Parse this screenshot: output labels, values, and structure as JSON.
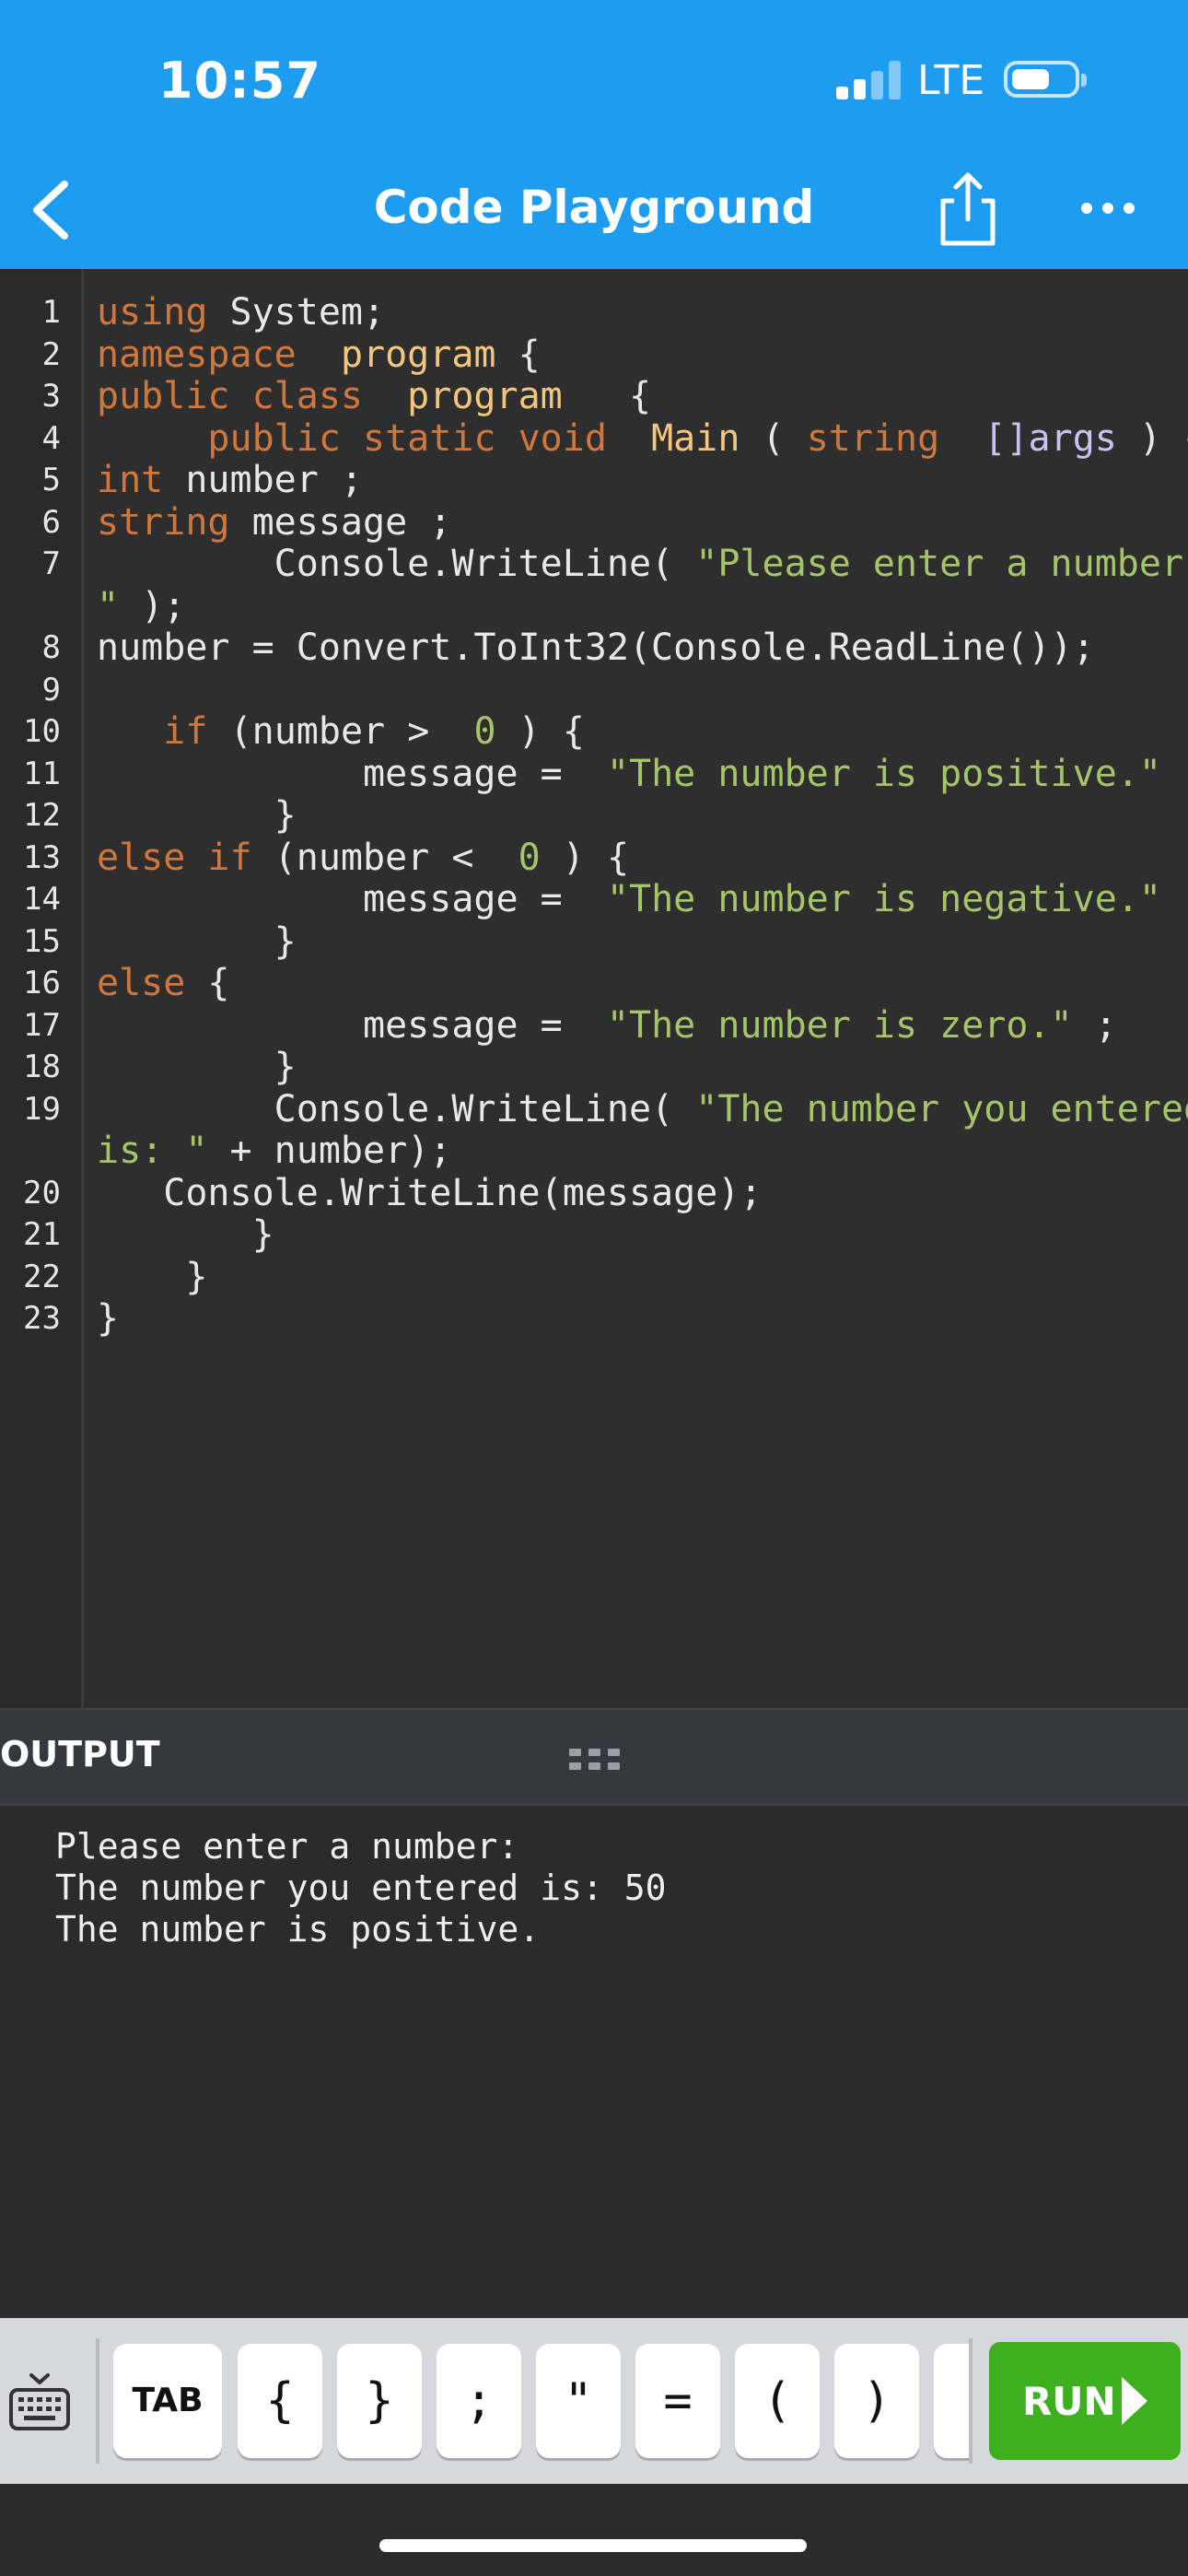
{
  "status_bar": {
    "time": "10:57",
    "network": "LTE"
  },
  "header": {
    "title": "Code Playground"
  },
  "code_lines": [
    {
      "n": "1"
    },
    {
      "n": "2"
    },
    {
      "n": "3"
    },
    {
      "n": "4"
    },
    {
      "n": "5"
    },
    {
      "n": "6"
    },
    {
      "n": "7"
    },
    {
      "n": ""
    },
    {
      "n": "8"
    },
    {
      "n": "9"
    },
    {
      "n": "10"
    },
    {
      "n": "11"
    },
    {
      "n": "12"
    },
    {
      "n": "13"
    },
    {
      "n": "14"
    },
    {
      "n": "15"
    },
    {
      "n": "16"
    },
    {
      "n": "17"
    },
    {
      "n": "18"
    },
    {
      "n": "19"
    },
    {
      "n": ""
    },
    {
      "n": "20"
    },
    {
      "n": "21"
    },
    {
      "n": "22"
    },
    {
      "n": "23"
    }
  ],
  "code_segments": [
    [
      [
        "kw",
        "using"
      ],
      [
        "",
        "System;"
      ]
    ],
    [
      [
        "kw",
        "namespace"
      ],
      [
        "",
        ""
      ],
      [
        "cls",
        "program"
      ],
      [
        "",
        "{"
      ]
    ],
    [
      [
        "kw",
        "public class"
      ],
      [
        "",
        ""
      ],
      [
        "cls",
        "program"
      ],
      [
        "",
        "  {"
      ]
    ],
    [
      [
        "",
        "    "
      ],
      [
        "kw",
        "public static void"
      ],
      [
        "",
        ""
      ],
      [
        "cls",
        "Main"
      ],
      [
        "",
        "("
      ],
      [
        "kw",
        "string"
      ],
      [
        "",
        ""
      ],
      [
        "typ",
        "[]args"
      ],
      [
        "",
        ") {"
      ]
    ],
    [
      [
        "kw",
        "int"
      ],
      [
        "",
        "number ;"
      ]
    ],
    [
      [
        "kw",
        "string"
      ],
      [
        "",
        "message ;"
      ]
    ],
    [
      [
        "",
        "        Console.WriteLine("
      ],
      [
        "str",
        "\"Please enter a number:"
      ]
    ],
    [
      [
        "str",
        "\""
      ],
      [
        "",
        ");"
      ]
    ],
    [
      [
        "",
        "number = Convert.ToInt32(Console.ReadLine());"
      ]
    ],
    [
      [
        "",
        ""
      ]
    ],
    [
      [
        "",
        "  "
      ],
      [
        "kw",
        "if"
      ],
      [
        "",
        "(number > "
      ],
      [
        "num",
        "0"
      ],
      [
        "",
        ") {"
      ]
    ],
    [
      [
        "",
        "            message = "
      ],
      [
        "str",
        "\"The number is positive.\""
      ],
      [
        "",
        ";"
      ]
    ],
    [
      [
        "",
        "        }"
      ]
    ],
    [
      [
        "kw",
        "else if"
      ],
      [
        "",
        "(number < "
      ],
      [
        "num",
        "0"
      ],
      [
        "",
        ") {"
      ]
    ],
    [
      [
        "",
        "            message = "
      ],
      [
        "str",
        "\"The number is negative.\""
      ],
      [
        "",
        ";"
      ]
    ],
    [
      [
        "",
        "        }"
      ]
    ],
    [
      [
        "kw",
        "else"
      ],
      [
        "",
        "{"
      ]
    ],
    [
      [
        "",
        "            message = "
      ],
      [
        "str",
        "\"The number is zero.\""
      ],
      [
        "",
        ";"
      ]
    ],
    [
      [
        "",
        "        }"
      ]
    ],
    [
      [
        "",
        "        Console.WriteLine("
      ],
      [
        "str",
        "\"The number you entered"
      ]
    ],
    [
      [
        "str",
        "is: \""
      ],
      [
        "",
        "+ number);"
      ]
    ],
    [
      [
        "",
        "   Console.WriteLine(message);"
      ]
    ],
    [
      [
        "",
        "       }"
      ]
    ],
    [
      [
        "",
        "    }"
      ]
    ],
    [
      [
        "",
        "}"
      ]
    ]
  ],
  "output": {
    "title": "OUTPUT",
    "lines": [
      "Please enter a number:",
      "The number you entered is: 50",
      "The number is positive."
    ]
  },
  "keys": [
    {
      "label": "TAB",
      "name": "key-tab"
    },
    {
      "label": "{",
      "name": "key-open-brace"
    },
    {
      "label": "}",
      "name": "key-close-brace"
    },
    {
      "label": ";",
      "name": "key-semicolon"
    },
    {
      "label": "\"",
      "name": "key-double-quote"
    },
    {
      "label": "=",
      "name": "key-equals"
    },
    {
      "label": "(",
      "name": "key-open-paren"
    },
    {
      "label": ")",
      "name": "key-close-paren"
    },
    {
      "label": "",
      "name": "key-partial"
    }
  ],
  "run_button": {
    "label": "RUN"
  },
  "colors": {
    "header": "#1e9cf0",
    "editor_bg": "#2e2e2e",
    "keyword": "#d0773d",
    "class_name": "#f5c77e",
    "string": "#a6c46a",
    "run_button": "#3cb01f"
  },
  "icons": {
    "back": "chevron-left-icon",
    "share": "share-icon",
    "more": "more-horizontal-icon",
    "drag": "drag-handle-icon",
    "keyboard": "keyboard-icon",
    "run": "play-icon"
  }
}
